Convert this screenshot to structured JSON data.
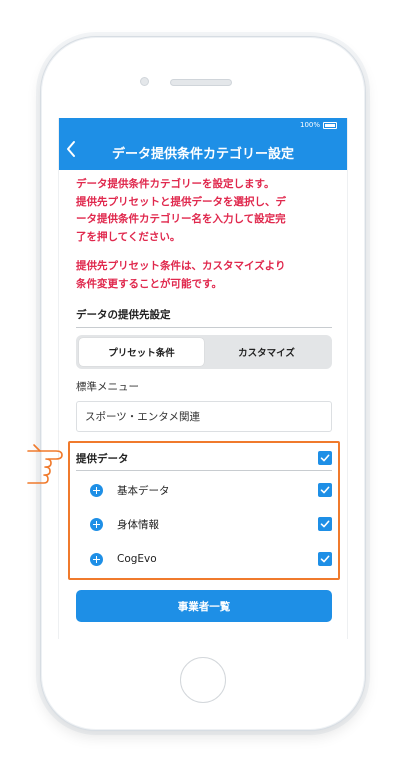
{
  "status_bar": {
    "battery_text": "100%"
  },
  "nav": {
    "title": "データ提供条件カテゴリー設定"
  },
  "intro": {
    "paragraph1": "データ提供条件カテゴリーを設定します。\n提供先プリセットと提供データを選択し、デ\nータ提供条件カテゴリー名を入力して設定完\n了を押してください。",
    "paragraph2": "提供先プリセット条件は、カスタマイズより\n条件変更することが可能です。"
  },
  "provider_section": {
    "title": "データの提供先設定"
  },
  "segmented": {
    "tabs": [
      {
        "label": "プリセット条件",
        "active": true
      },
      {
        "label": "カスタマイズ",
        "active": false
      }
    ]
  },
  "menu": {
    "label": "標準メニュー",
    "value": "スポーツ・エンタメ関連"
  },
  "data_section": {
    "header_label": "提供データ",
    "header_checked": true,
    "items": [
      {
        "label": "基本データ",
        "checked": true
      },
      {
        "label": "身体情報",
        "checked": true
      },
      {
        "label": "CogEvo",
        "checked": true
      }
    ]
  },
  "action": {
    "label": "事業者一覧"
  },
  "colors": {
    "accent": "#1e8fe6",
    "warning_text": "#e0284d",
    "highlight": "#f07a2c"
  },
  "icons": {
    "back": "chevron-left-icon",
    "expand": "plus-circle-icon",
    "check": "checkmark-icon",
    "pointer": "pointing-hand-icon"
  }
}
